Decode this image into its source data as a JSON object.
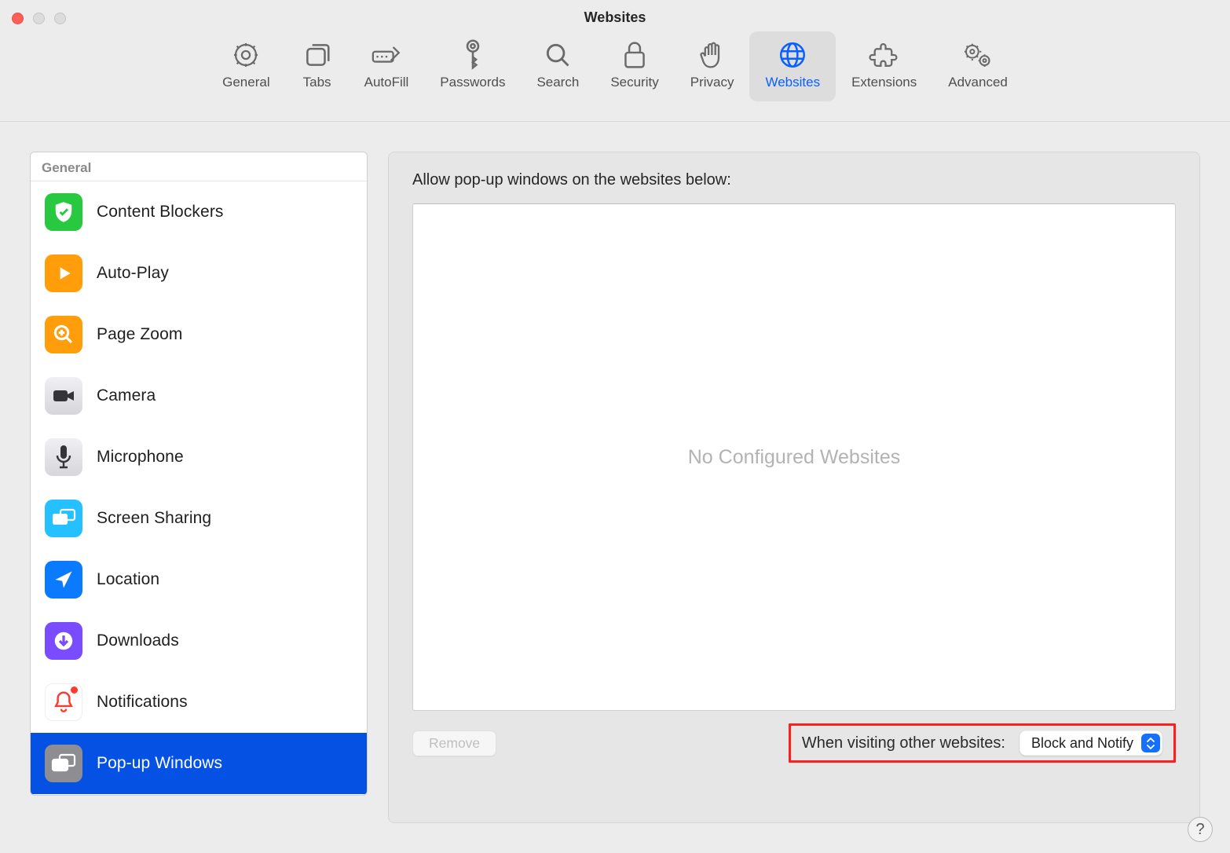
{
  "window": {
    "title": "Websites"
  },
  "tabs": [
    {
      "id": "general",
      "label": "General"
    },
    {
      "id": "tabs",
      "label": "Tabs"
    },
    {
      "id": "autofill",
      "label": "AutoFill"
    },
    {
      "id": "passwords",
      "label": "Passwords"
    },
    {
      "id": "search",
      "label": "Search"
    },
    {
      "id": "security",
      "label": "Security"
    },
    {
      "id": "privacy",
      "label": "Privacy"
    },
    {
      "id": "websites",
      "label": "Websites",
      "active": true
    },
    {
      "id": "extensions",
      "label": "Extensions"
    },
    {
      "id": "advanced",
      "label": "Advanced"
    }
  ],
  "sidebar": {
    "section_title": "General",
    "items": [
      {
        "id": "content-blockers",
        "label": "Content Blockers",
        "color": "#28c940"
      },
      {
        "id": "auto-play",
        "label": "Auto-Play",
        "color": "#ff9d0a"
      },
      {
        "id": "page-zoom",
        "label": "Page Zoom",
        "color": "#ff9d0a"
      },
      {
        "id": "camera",
        "label": "Camera",
        "color": "#e2e2e6"
      },
      {
        "id": "microphone",
        "label": "Microphone",
        "color": "#e2e2e6"
      },
      {
        "id": "screen-sharing",
        "label": "Screen Sharing",
        "color": "#24c0ff"
      },
      {
        "id": "location",
        "label": "Location",
        "color": "#0a7aff"
      },
      {
        "id": "downloads",
        "label": "Downloads",
        "color": "#7a4cff"
      },
      {
        "id": "notifications",
        "label": "Notifications",
        "color": "#ffffff"
      },
      {
        "id": "popup-windows",
        "label": "Pop-up Windows",
        "color": "#8e8e92",
        "selected": true
      }
    ]
  },
  "detail": {
    "heading": "Allow pop-up windows on the websites below:",
    "empty_text": "No Configured Websites",
    "remove_label": "Remove",
    "footer_label": "When visiting other websites:",
    "dropdown_value": "Block and Notify"
  },
  "help": "?"
}
